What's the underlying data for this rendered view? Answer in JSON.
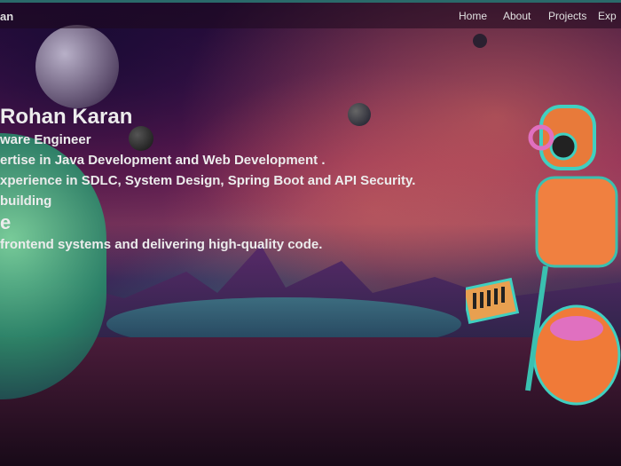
{
  "nav": {
    "brand": "an",
    "links": [
      "Home",
      "About",
      "Projects",
      "Exp"
    ]
  },
  "hero": {
    "name": "Rohan Karan",
    "role": "ware Engineer",
    "lines": [
      "ertise in Java Development and Web Development .",
      "xperience in SDLC, System Design, Spring Boot and API Security.",
      "building"
    ],
    "heading": "e",
    "tagline": "frontend systems and delivering high-quality code."
  }
}
